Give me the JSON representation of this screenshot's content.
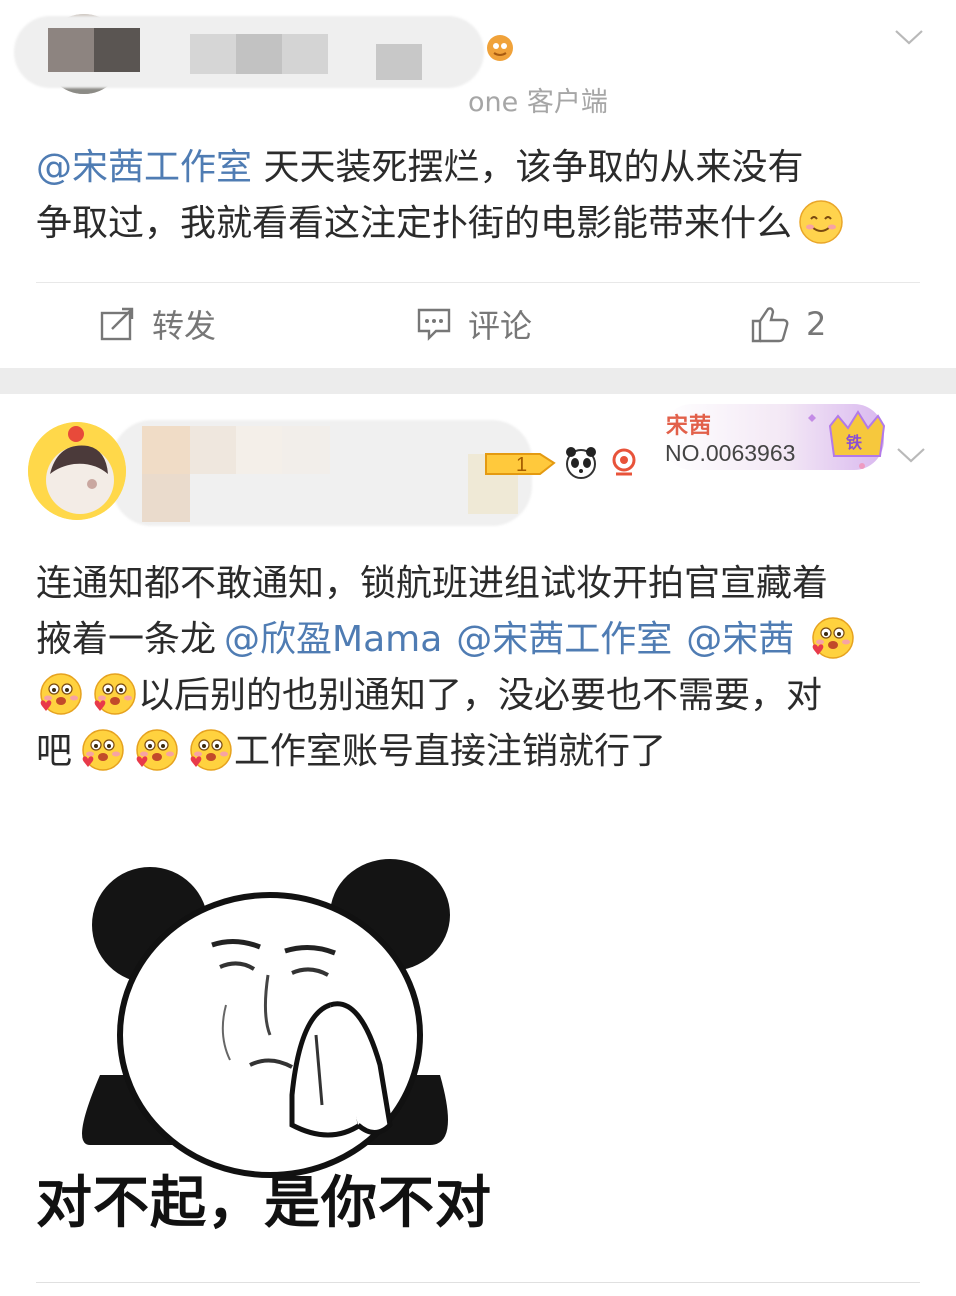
{
  "post1": {
    "source": "one 客户端",
    "text_mention": "@宋茜工作室",
    "text_line1_rest": " 天天装死摆烂，该争取的从来没有",
    "text_line2": "争取过，我就看看这注定扑街的电影能带来什么",
    "actions": {
      "repost_label": "转发",
      "comment_label": "评论",
      "like_count": "2"
    }
  },
  "post2": {
    "badge_title": "宋茜",
    "badge_number": "NO.0063963",
    "badge_icon": "铁",
    "text_line1": "连通知都不敢通知，锁航班进组试妆开拍官宣藏着",
    "text_line2_prefix": "掖着一条龙",
    "mention_1": "@欣盈Mama",
    "mention_2": "@宋茜工作室",
    "mention_3": "@宋茜",
    "text_line3": "以后别的也别通知了，没必要也不需要，对",
    "text_line4_prefix": "吧",
    "text_line4_suffix": "工作室账号直接注销就行了",
    "meme_caption": "对不起，是你不对"
  },
  "icons": {
    "repost": "repost-icon",
    "comment": "comment-icon",
    "like": "thumbs-up-icon",
    "menu": "chevron-down-icon",
    "smile": "smile-emoji-icon",
    "love": "love-face-emoji-icon",
    "panda": "panda-meme-icon"
  },
  "colors": {
    "mention": "#4f7cb3",
    "separator": "#ececec",
    "action_text": "#777777",
    "badge_accent": "#e2604a"
  }
}
